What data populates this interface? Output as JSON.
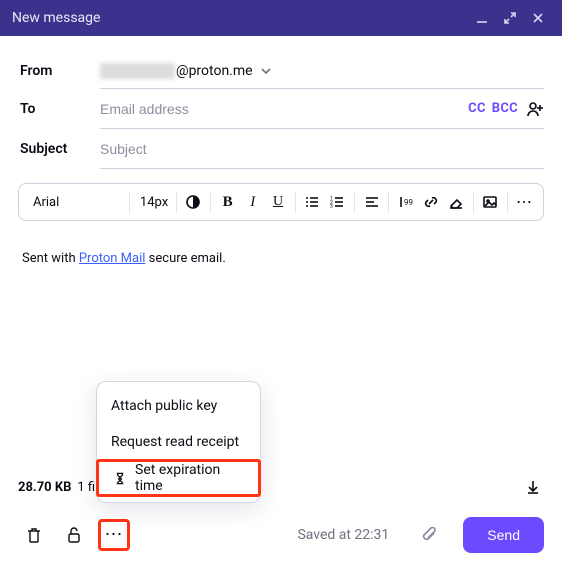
{
  "titlebar": {
    "title": "New message"
  },
  "fields": {
    "from_label": "From",
    "from_domain": "@proton.me",
    "to_label": "To",
    "to_placeholder": "Email address",
    "cc_label": "CC",
    "bcc_label": "BCC",
    "subject_label": "Subject",
    "subject_placeholder": "Subject"
  },
  "toolbar": {
    "font": "Arial",
    "size": "14px"
  },
  "signature": {
    "prefix": "Sent with ",
    "link_text": "Proton Mail",
    "suffix": " secure email."
  },
  "attachments": {
    "size": "28.70 KB",
    "count_text": "1 fil"
  },
  "popup": {
    "item1": "Attach public key",
    "item2": "Request read receipt",
    "item3": "Set expiration time"
  },
  "footer": {
    "saved_text": "Saved at 22:31",
    "send_label": "Send"
  }
}
